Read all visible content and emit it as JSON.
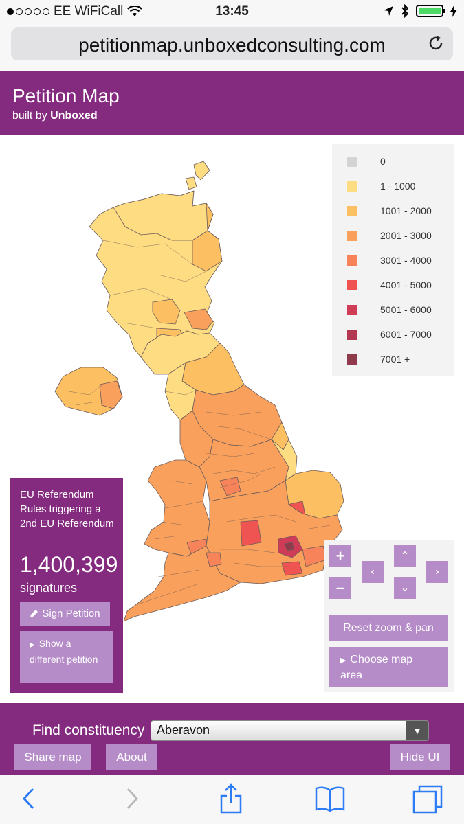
{
  "status_bar": {
    "carrier": "EE WiFiCall",
    "time": "13:45"
  },
  "browser": {
    "url": "petitionmap.unboxedconsulting.com"
  },
  "header": {
    "title": "Petition Map",
    "built_by_prefix": "built by",
    "built_by_name": "Unboxed"
  },
  "legend": [
    {
      "label": "0",
      "color": "#d3d3d3"
    },
    {
      "label": "1 - 1000",
      "color": "#fedc82"
    },
    {
      "label": "1001 - 2000",
      "color": "#fcc062"
    },
    {
      "label": "2001 - 3000",
      "color": "#f9a15c"
    },
    {
      "label": "3001 - 4000",
      "color": "#f7835a"
    },
    {
      "label": "4001 - 5000",
      "color": "#f05452"
    },
    {
      "label": "5001 - 6000",
      "color": "#d03c58"
    },
    {
      "label": "6001 - 7000",
      "color": "#b33851"
    },
    {
      "label": "7001 +",
      "color": "#8f3b4c"
    }
  ],
  "petition": {
    "title": "EU Referendum Rules triggering a 2nd EU Referendum",
    "count": "1,400,399",
    "count_label": "signatures",
    "sign_label": "Sign Petition",
    "other_label": "Show a different petition"
  },
  "controls": {
    "reset_label": "Reset zoom & pan",
    "choose_label": "Choose map area"
  },
  "bottom_bar": {
    "find_label": "Find constituency",
    "selected_constituency": "Aberavon",
    "share_label": "Share map",
    "about_label": "About",
    "hide_label": "Hide UI"
  },
  "colors": {
    "brand_purple": "#842a7f",
    "button_lilac": "#b58bc8",
    "safari_blue": "#2d7cf6"
  }
}
